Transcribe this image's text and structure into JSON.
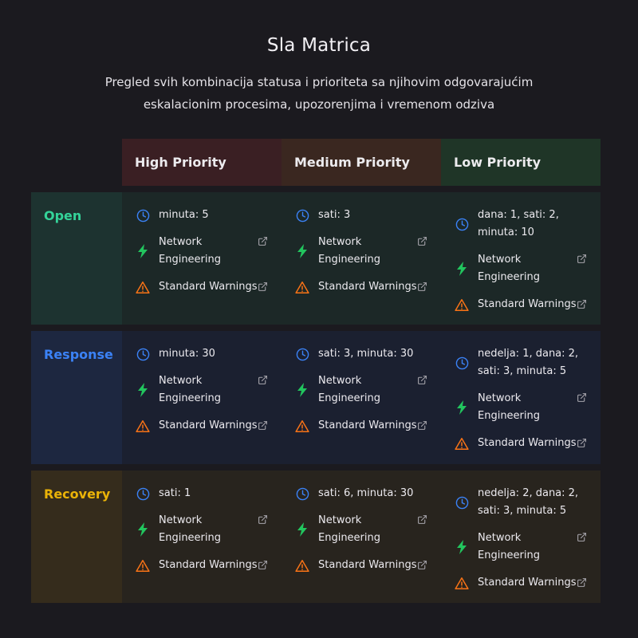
{
  "title": "Sla Matrica",
  "subtitle": "Pregled svih kombinacija statusa i prioriteta sa njihovim odgovarajućim eskalacionim procesima, upozorenjima i vremenom odziva",
  "columns": [
    {
      "label": "High Priority",
      "bg": "#3a1f23"
    },
    {
      "label": "Medium Priority",
      "bg": "#3a2720"
    },
    {
      "label": "Low Priority",
      "bg": "#1f3527"
    }
  ],
  "escalation_label": "Network Engineering",
  "warnings_label": "Standard Warnings",
  "colors": {
    "clock": "#3b82f6",
    "bolt": "#22c55e",
    "warning": "#f97316",
    "external": "#a8a6ad"
  },
  "rows": [
    {
      "label": "Open",
      "label_color": "#34d399",
      "label_bg": "#1d3330",
      "bg": "#1c2827",
      "cells": [
        {
          "time": "minuta: 5"
        },
        {
          "time": "sati: 3"
        },
        {
          "time": "dana: 1, sati: 2, minuta: 10"
        }
      ]
    },
    {
      "label": "Response",
      "label_color": "#3b82f6",
      "label_bg": "#1d2740",
      "bg": "#1b2030",
      "cells": [
        {
          "time": "minuta: 30"
        },
        {
          "time": "sati: 3, minuta: 30"
        },
        {
          "time": "nedelja: 1, dana: 2, sati: 3, minuta: 5"
        }
      ]
    },
    {
      "label": "Recovery",
      "label_color": "#eab308",
      "label_bg": "#352c1c",
      "bg": "#28241e",
      "cells": [
        {
          "time": "sati: 1"
        },
        {
          "time": "sati: 6, minuta: 30"
        },
        {
          "time": "nedelja: 2, dana: 2, sati: 3, minuta: 5"
        }
      ]
    }
  ]
}
